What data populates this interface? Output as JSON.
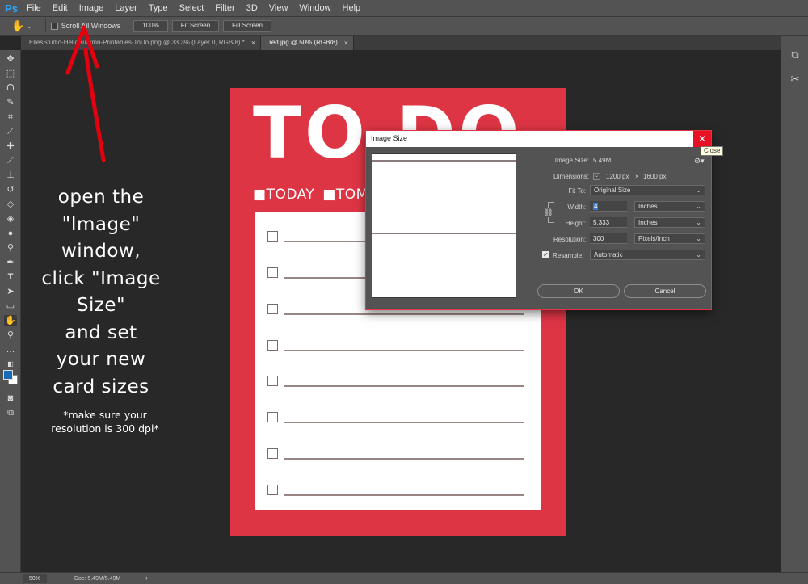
{
  "menubar": {
    "logo": "Ps",
    "items": [
      "File",
      "Edit",
      "Image",
      "Layer",
      "Type",
      "Select",
      "Filter",
      "3D",
      "View",
      "Window",
      "Help"
    ]
  },
  "options": {
    "scroll_all_label": "Scroll All Windows",
    "btn_100": "100%",
    "btn_fit": "Fit Screen",
    "btn_fill": "Fill Screen"
  },
  "tabs": [
    {
      "label": "EllesStudio-HelloAutumn-Printables-ToDo.png @ 33.3% (Layer 0, RGB/8) *",
      "close": "×"
    },
    {
      "label": "red.jpg @ 50% (RGB/8)",
      "close": "×"
    }
  ],
  "document": {
    "title": "TO DO",
    "sub1": "■TODAY",
    "sub2": "■TOMORROW",
    "colors": {
      "background": "#de3545",
      "panel": "#ffffff"
    }
  },
  "instructions": {
    "lines": [
      "open the",
      "\"Image\"",
      "window,",
      "click \"Image",
      "Size\"",
      "and set",
      "your new",
      "card sizes"
    ],
    "note_lines": [
      "*make sure your",
      "resolution is 300 dpi*"
    ]
  },
  "dialog": {
    "title": "Image Size",
    "close_tooltip": "Close",
    "image_size_label": "Image Size:",
    "image_size_value": "5.49M",
    "dimensions_label": "Dimensions:",
    "dim_width": "1200 px",
    "dim_x": "×",
    "dim_height": "1600 px",
    "fit_to_label": "Fit To:",
    "fit_to_value": "Original Size",
    "width_label": "Width:",
    "width_value": "4",
    "width_unit": "Inches",
    "height_label": "Height:",
    "height_value": "5.333",
    "height_unit": "Inches",
    "resolution_label": "Resolution:",
    "resolution_value": "300",
    "resolution_unit": "Pixels/Inch",
    "resample_label": "Resample:",
    "resample_value": "Automatic",
    "ok_label": "OK",
    "cancel_label": "Cancel"
  },
  "status": {
    "zoom": "50%",
    "doc_info": "Doc: 5.49M/5.49M",
    "caret": "›"
  }
}
